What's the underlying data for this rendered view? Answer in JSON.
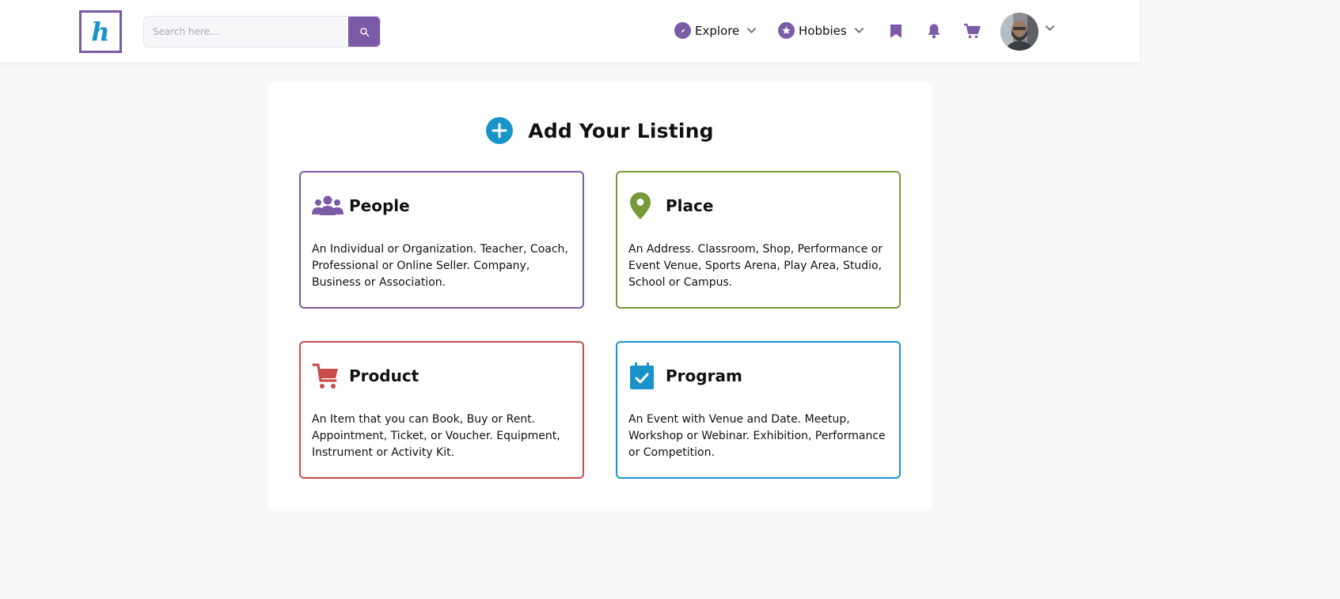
{
  "header": {
    "logo_letter": "h",
    "search": {
      "placeholder": "Search here..."
    },
    "nav": {
      "explore_label": "Explore",
      "hobbies_label": "Hobbies"
    }
  },
  "main": {
    "title": "Add Your Listing",
    "cards": [
      {
        "title": "People",
        "description": "An Individual or Organization.  Teacher, Coach, Professional or Online Seller.  Company, Business or Association.",
        "icon": "users-icon",
        "color": "#7b5aa6"
      },
      {
        "title": "Place",
        "description": "An Address.  Classroom, Shop, Performance or Event Venue, Sports Arena, Play Area, Studio, School or Campus.",
        "icon": "map-pin-icon",
        "color": "#76993a"
      },
      {
        "title": "Product",
        "description": "An Item that you can Book, Buy or Rent.  Appointment, Ticket, or Voucher.  Equipment, Instrument or Activity Kit.",
        "icon": "shopping-cart-icon",
        "color": "#c94c4c"
      },
      {
        "title": "Program",
        "description": "An Event with Venue and Date.  Meetup, Workshop or Webinar.  Exhibition, Performance or Competition.",
        "icon": "calendar-check-icon",
        "color": "#1a93c9"
      }
    ]
  },
  "colors": {
    "brand_purple": "#7b5aa6",
    "brand_blue": "#1a93c9",
    "page_bg": "#f7f8fa"
  }
}
